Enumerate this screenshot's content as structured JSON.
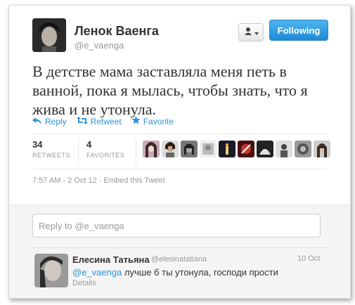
{
  "tweet": {
    "author_name": "Ленок Ваенга",
    "author_handle": "@e_vaenga",
    "follow_label": "Following",
    "text": "В детстве мама заставляла меня петь в ванной, пока я мылась, чтобы знать, что я жива и не утонула.",
    "actions": {
      "reply": "Reply",
      "retweet": "Retweet",
      "favorite": "Favorite"
    },
    "stats": {
      "retweets_count": "34",
      "retweets_label": "RETWEETS",
      "favorites_count": "4",
      "favorites_label": "FAVORITES"
    },
    "timestamp": "7:57 AM - 2 Oct 12",
    "separator": "·",
    "embed_label": "Embed this Tweet"
  },
  "reply_box": {
    "placeholder": "Reply to @e_vaenga"
  },
  "reply": {
    "author_name": "Елесина Татьяна",
    "author_handle": "@elesinatatiana",
    "date": "10 Oct",
    "mention": "@e_vaenga",
    "text": " лучше б ты утонула, господи прости",
    "details_label": "Details"
  },
  "colors": {
    "link": "#2f93d8",
    "follow_button": "#1f8ad4"
  }
}
